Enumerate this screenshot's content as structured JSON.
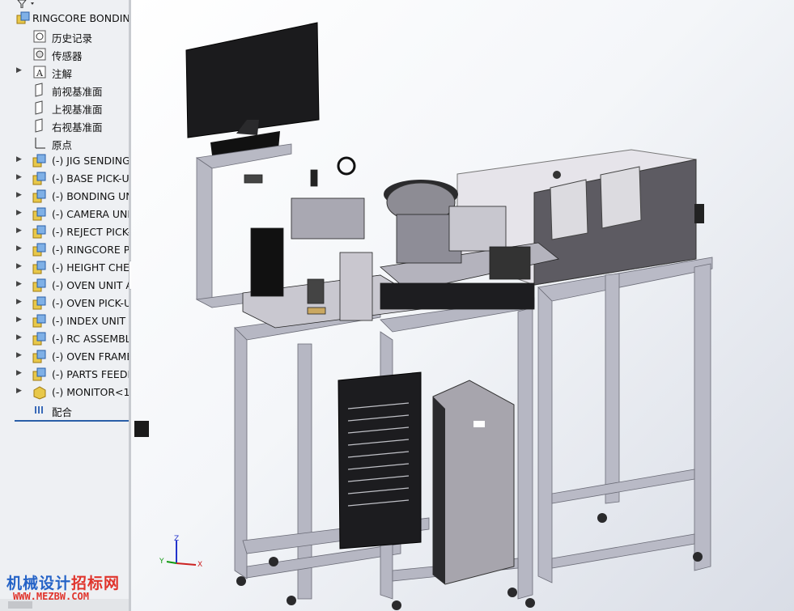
{
  "tree": {
    "root": {
      "label": "RINGCORE BONDIN",
      "icon": "assembly-icon"
    },
    "items": [
      {
        "label": "历史记录",
        "icon": "history-icon",
        "expandable": false
      },
      {
        "label": "传感器",
        "icon": "sensor-icon",
        "expandable": false
      },
      {
        "label": "注解",
        "icon": "annotation-icon",
        "expandable": true
      },
      {
        "label": "前视基准面",
        "icon": "plane-icon",
        "expandable": false
      },
      {
        "label": "上视基准面",
        "icon": "plane-icon",
        "expandable": false
      },
      {
        "label": "右视基准面",
        "icon": "plane-icon",
        "expandable": false
      },
      {
        "label": "原点",
        "icon": "origin-icon",
        "expandable": false
      },
      {
        "label": "(-) JIG SENDING",
        "icon": "subassembly-icon",
        "expandable": true
      },
      {
        "label": "(-) BASE PICK-UI",
        "icon": "subassembly-icon",
        "expandable": true
      },
      {
        "label": "(-) BONDING UN",
        "icon": "subassembly-icon",
        "expandable": true
      },
      {
        "label": "(-) CAMERA UNI",
        "icon": "subassembly-icon",
        "expandable": true
      },
      {
        "label": "(-) REJECT PICK-",
        "icon": "subassembly-icon",
        "expandable": true
      },
      {
        "label": "(-) RINGCORE PI",
        "icon": "subassembly-icon",
        "expandable": true
      },
      {
        "label": "(-) HEIGHT CHEC",
        "icon": "subassembly-icon",
        "expandable": true
      },
      {
        "label": "(-) OVEN UNIT A",
        "icon": "subassembly-icon",
        "expandable": true
      },
      {
        "label": "(-) OVEN PICK-U",
        "icon": "subassembly-icon",
        "expandable": true
      },
      {
        "label": "(-) INDEX UNIT A",
        "icon": "subassembly-icon",
        "expandable": true
      },
      {
        "label": "(-) RC ASSEMBL",
        "icon": "subassembly-icon",
        "expandable": true
      },
      {
        "label": "(-) OVEN FRAME",
        "icon": "subassembly-icon",
        "expandable": true
      },
      {
        "label": "(-) PARTS FEEDE",
        "icon": "subassembly-icon",
        "expandable": true
      },
      {
        "label": "(-) MONITOR<1",
        "icon": "part-icon",
        "expandable": true
      },
      {
        "label": "配合",
        "icon": "mates-icon",
        "expandable": false
      }
    ]
  },
  "triad": {
    "z": "Z",
    "y": "Y",
    "x": "X"
  },
  "watermark": {
    "line1_a": "机械设计",
    "line1_b": "招标网",
    "line2": "WWW.MEZBW.COM"
  },
  "colors": {
    "frame": "#b9bac6",
    "dark": "#1c1c1e",
    "accent": "#2563c7",
    "wm_red": "#e0342c"
  }
}
